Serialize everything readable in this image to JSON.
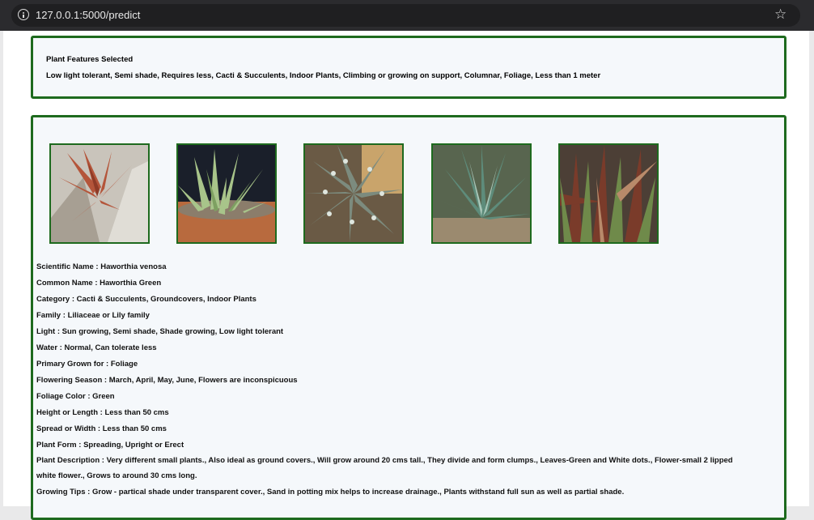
{
  "browser": {
    "url": "127.0.0.1:5000/predict"
  },
  "features": {
    "title": "Plant Features Selected",
    "text": "Low light tolerant, Semi shade, Requires less, Cacti & Succulents, Indoor Plants, Climbing or growing on support, Columnar, Foliage, Less than 1 meter"
  },
  "thumbnails": [
    {
      "name": "plant-image-1"
    },
    {
      "name": "plant-image-2"
    },
    {
      "name": "plant-image-3"
    },
    {
      "name": "plant-image-4"
    },
    {
      "name": "plant-image-5"
    }
  ],
  "details": [
    {
      "label": "Scientific Name",
      "sep": " : ",
      "value": "Haworthia venosa"
    },
    {
      "label": "Common Name",
      "sep": " : ",
      "value": "Haworthia Green"
    },
    {
      "label": "Category",
      "sep": " : ",
      "value": "Cacti & Succulents, Groundcovers, Indoor Plants"
    },
    {
      "label": "Family",
      "sep": " : ",
      "value": "Liliaceae or Lily family"
    },
    {
      "label": "Light",
      "sep": " : ",
      "value": "Sun growing, Semi shade, Shade growing, Low light tolerant"
    },
    {
      "label": "Water",
      "sep": " : ",
      "value": "Normal, Can tolerate less"
    },
    {
      "label": "Primary Grown for",
      "sep": " : ",
      "value": "Foliage"
    },
    {
      "label": "Flowering Season",
      "sep": " : ",
      "value": "March, April, May, June, Flowers are inconspicuous"
    },
    {
      "label": "Foliage Color",
      "sep": " : ",
      "value": "Green"
    },
    {
      "label": "Height or Length",
      "sep": " : ",
      "value": "Less than 50 cms"
    },
    {
      "label": "Spread or Width",
      "sep": " : ",
      "value": "Less than 50 cms"
    },
    {
      "label": "Plant Form",
      "sep": " : ",
      "value": "Spreading, Upright or Erect"
    },
    {
      "label": "Plant Description",
      "sep": " : ",
      "value": "Very different small plants., Also ideal as ground covers., Will grow around 20 cms tall., They divide and form clumps., Leaves-Green and White dots., Flower-small 2 lipped"
    },
    {
      "label": "Growing Tips",
      "sep": " : ",
      "value": "Grow - partical shade under transparent cover., Sand in potting mix helps to increase drainage., Plants withstand full sun as well as partial shade."
    }
  ],
  "description_continued": "white flower., Grows to around 30 cms long."
}
